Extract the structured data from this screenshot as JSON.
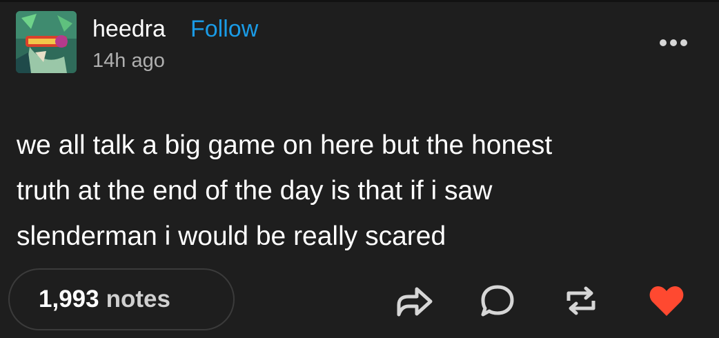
{
  "post": {
    "author": "heedra",
    "follow_label": "Follow",
    "timestamp": "14h ago",
    "body_lines": [
      "we all talk a big game on here but the honest",
      "truth at the end of the day is that if i saw",
      "slenderman i would be really scared"
    ]
  },
  "footer": {
    "notes_count": "1,993",
    "notes_label": "notes"
  },
  "icons": {
    "more": "more-options-icon",
    "share": "share-icon",
    "reply": "reply-icon",
    "reblog": "reblog-icon",
    "like": "heart-icon"
  },
  "colors": {
    "background": "#1e1e1e",
    "follow": "#1a9be6",
    "like": "#ff4930",
    "muted_text": "#b0b0b0"
  }
}
